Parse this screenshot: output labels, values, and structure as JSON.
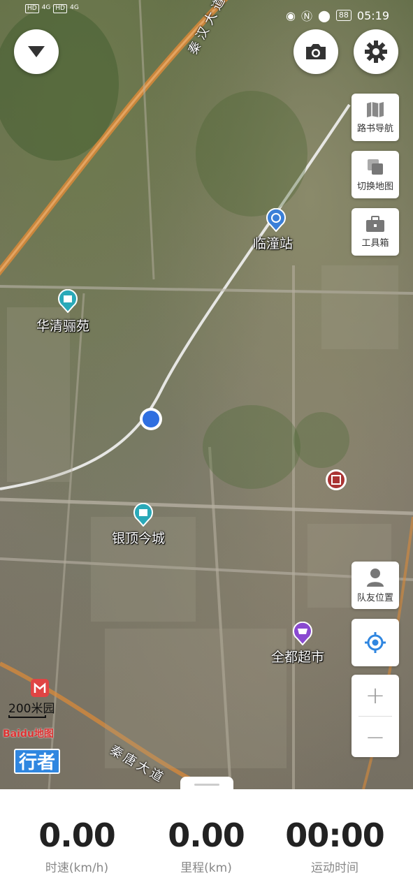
{
  "status_bar": {
    "left_indicators": [
      "HD",
      "4G",
      "HD",
      "4G"
    ],
    "battery": "88",
    "time": "05:19"
  },
  "map": {
    "pois": [
      {
        "name": "临潼站"
      },
      {
        "name": "华清骊苑"
      },
      {
        "name": "银顶今城"
      },
      {
        "name": "全都超市"
      }
    ],
    "road_labels": [
      "秦汉大道",
      "秦唐大道"
    ],
    "scale_label": "200米",
    "scale_suffix": "园",
    "brand": "Baidu地图",
    "app_badge": "行者"
  },
  "side_buttons": {
    "roadbook": "路书导航",
    "switch_map": "切换地图",
    "toolbox": "工具箱",
    "teammates": "队友位置"
  },
  "zoom": {
    "in": "+",
    "out": "−"
  },
  "stats": {
    "speed_value": "0.00",
    "speed_label": "时速(km/h)",
    "distance_value": "0.00",
    "distance_label": "里程(km)",
    "time_value": "00:00",
    "time_label": "运动时间"
  },
  "colors": {
    "accent": "#2f86e0",
    "poi_blue": "#3a7fd8",
    "poi_teal": "#2aa9b8",
    "poi_purple": "#8a4ad0",
    "road_orange": "#d98a3a"
  }
}
